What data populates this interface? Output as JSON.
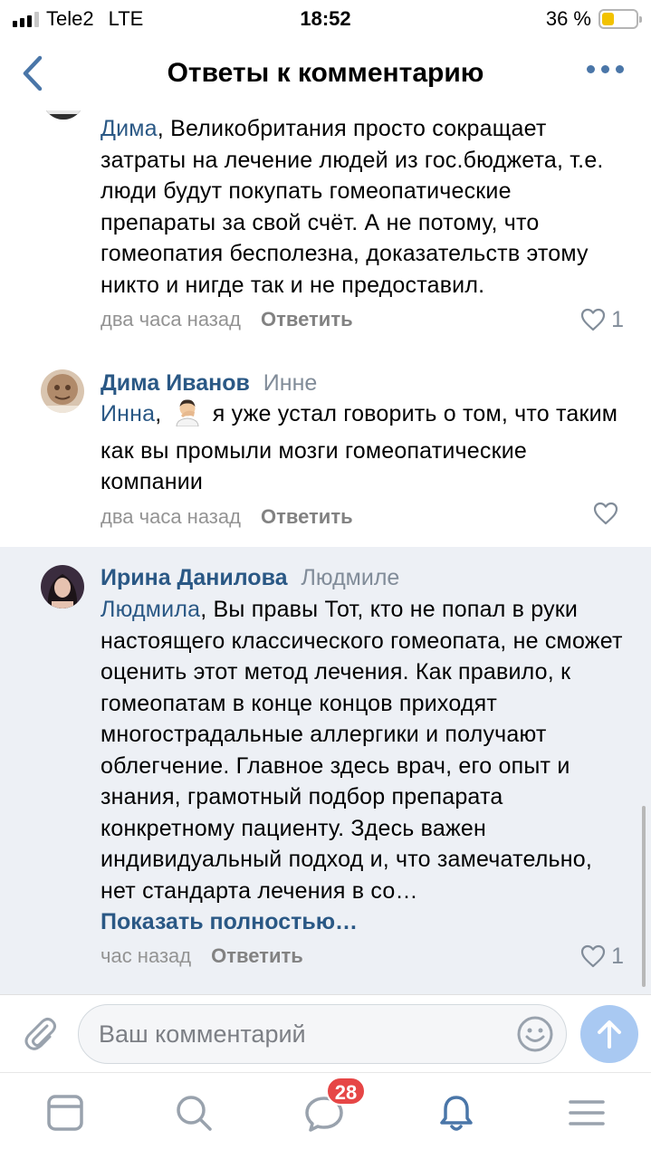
{
  "status_bar": {
    "carrier": "Tele2",
    "network": "LTE",
    "time": "18:52",
    "battery_text": "36 %",
    "battery_level": 0.36
  },
  "nav": {
    "title": "Ответы к комментарию"
  },
  "comments": [
    {
      "author": "",
      "reply_to": "",
      "mention": "Дима",
      "text": ", Великобритания просто сокращает затраты на лечение людей из гос.бюджета, т.е. люди будут покупать гомеопатические препараты за свой счёт. А не потому, что гомеопатия бесполезна, доказательств этому никто и нигде так и не предоставил.",
      "time": "два часа назад",
      "reply_label": "Ответить",
      "likes": "1"
    },
    {
      "author": "Дима Иванов",
      "reply_to": "Инне",
      "mention": "Инна",
      "text": " я уже устал говорить о том, что таким как вы промыли мозги гомеопатические компании",
      "emoji_icon": "man-facepalming-emoji",
      "time": "два часа назад",
      "reply_label": "Ответить",
      "likes": ""
    },
    {
      "author": "Ирина Данилова",
      "reply_to": "Людмиле",
      "mention": "Людмила",
      "text": ", Вы правы Тот, кто не попал в руки настоящего классического гомеопата, не сможет оценить этот метод лечения. Как правило, к гомеопатам в конце концов приходят многострадальные аллергики и получают облегчение. Главное здесь врач, его опыт и знания, грамотный подбор препарата конкретному пациенту. Здесь важен индивидуальный подход и, что замечательно, нет стандарта лечения в со…",
      "show_more": "Показать полностью…",
      "time": "час назад",
      "reply_label": "Ответить",
      "likes": "1"
    }
  ],
  "input": {
    "placeholder": "Ваш комментарий"
  },
  "tabbar": {
    "messages_badge": "28"
  },
  "colors": {
    "accent": "#2a5885",
    "highlight": "#edf0f5",
    "badge": "#e64646",
    "send_button": "#a9c9f2"
  }
}
